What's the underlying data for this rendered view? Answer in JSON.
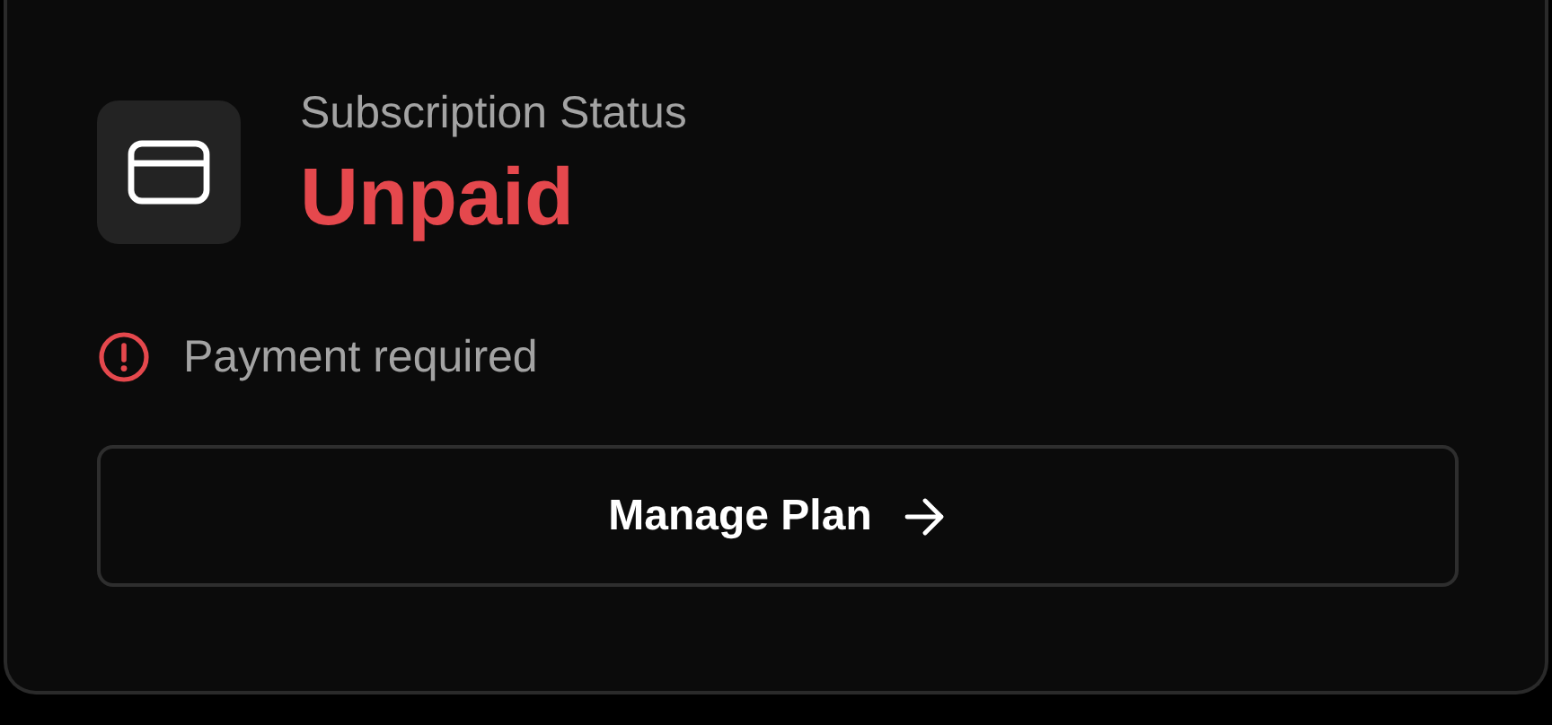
{
  "subscription": {
    "label": "Subscription Status",
    "status": "Unpaid",
    "kind": "unpaid"
  },
  "notice": {
    "text": "Payment required",
    "kind": "error"
  },
  "button": {
    "label": "Manage Plan"
  }
}
